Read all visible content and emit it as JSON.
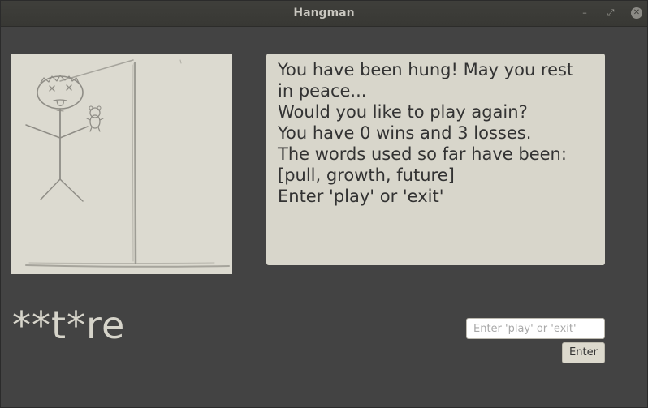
{
  "window": {
    "title": "Hangman",
    "controls": {
      "minimize": "–",
      "maximize": "⤢",
      "close": "✕"
    }
  },
  "message": {
    "lines": [
      "You have been hung! May you rest",
      "in peace...",
      "Would you like to play again?",
      "You have 0 wins and 3 losses.",
      "The words used so far have been:",
      "[pull, growth, future]",
      "Enter 'play' or 'exit'"
    ]
  },
  "word_display": "**t*re",
  "input": {
    "value": "",
    "placeholder": "Enter 'play' or 'exit'"
  },
  "enter_button": "Enter",
  "image": {
    "depicts": "hanged-stick-figure-drawing"
  },
  "colors": {
    "background": "#434343",
    "panel": "#d8d6cb",
    "word": "#d6d4ca"
  }
}
